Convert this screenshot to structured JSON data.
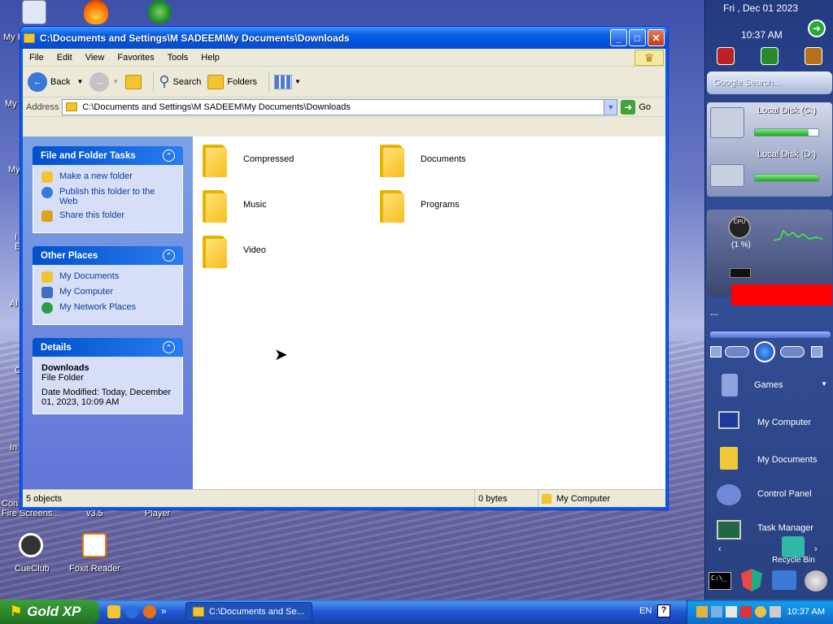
{
  "window": {
    "title": "C:\\Documents and Settings\\M SADEEM\\My Documents\\Downloads",
    "controls": {
      "minimize": "_",
      "maximize": "□",
      "close": "✕"
    }
  },
  "menu": [
    "File",
    "Edit",
    "View",
    "Favorites",
    "Tools",
    "Help"
  ],
  "toolbar": {
    "back": "Back",
    "search": "Search",
    "folders": "Folders"
  },
  "address": {
    "label": "Address",
    "value": "C:\\Documents and Settings\\M SADEEM\\My Documents\\Downloads",
    "go": "Go"
  },
  "taskpane": {
    "file_tasks": {
      "title": "File and Folder Tasks",
      "items": [
        "Make a new folder",
        "Publish this folder to the Web",
        "Share this folder"
      ]
    },
    "other_places": {
      "title": "Other Places",
      "items": [
        "My Documents",
        "My Computer",
        "My Network Places"
      ]
    },
    "details": {
      "title": "Details",
      "name": "Downloads",
      "type": "File Folder",
      "modified": "Date Modified: Today, December 01, 2023, 10:09 AM"
    }
  },
  "folders": [
    "Compressed",
    "Documents",
    "Music",
    "Programs",
    "Video"
  ],
  "status": {
    "objects": "5 objects",
    "size": "0 bytes",
    "location": "My Computer"
  },
  "desktop": {
    "icons": [
      "CueClub",
      "Foxit Reader"
    ],
    "partial_labels": [
      "My I",
      "My",
      "My",
      "I",
      "E",
      "Al",
      "C",
      "In",
      "Con",
      "Fire Screens...",
      "v3.5",
      "Player"
    ]
  },
  "sidebar": {
    "date": "Fri , Dec 01 2023",
    "time": "10:37 AM",
    "search_placeholder": "Google Search...",
    "disks": [
      {
        "label": "Local Disk (C:)",
        "used": 0.85
      },
      {
        "label": "Local Disk (D:)",
        "used": 1.0
      }
    ],
    "cpu_label": "CPU",
    "cpu_percent": "(1 %)",
    "media_dash": "---",
    "launch": [
      "Games",
      "My Computer",
      "My Documents",
      "Control Panel",
      "Task Manager",
      "Recycle Bin"
    ]
  },
  "taskbar": {
    "start": "Gold XP",
    "task": "C:\\Documents and Se...",
    "lang": "EN",
    "help": "?",
    "time": "10:37 AM",
    "chevron": "»"
  },
  "colors": {
    "xp_blue": "#0054e3",
    "taskpane": "#6375d6",
    "start_green": "#2d8a2d"
  }
}
